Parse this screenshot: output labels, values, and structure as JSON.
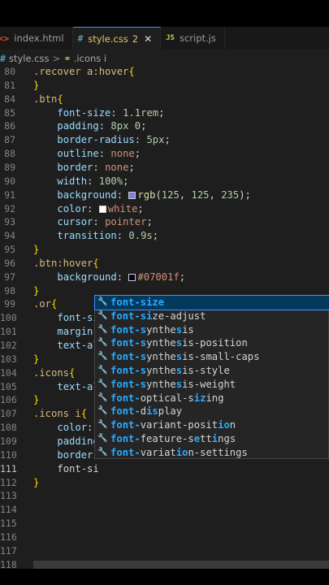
{
  "tabs": [
    {
      "icon": "<>",
      "label": "index.html",
      "badge": "",
      "active": false
    },
    {
      "icon": "#",
      "label": "style.css",
      "badge": "2",
      "active": true
    },
    {
      "icon": "JS",
      "label": "script.js",
      "badge": "",
      "active": false
    }
  ],
  "breadcrumb": {
    "file": "style.css",
    "symbol": ".icons i"
  },
  "lines": [
    {
      "n": "80",
      "html": "<span class='sel'>.recover a:hover</span><span class='br'>{</span>"
    },
    {
      "n": "81",
      "html": "<span class='br'>}</span>"
    },
    {
      "n": "84",
      "html": "<span class='sel'>.btn</span><span class='br'>{</span>"
    },
    {
      "n": "85",
      "html": "    <span class='prop'>font-size</span>: <span class='num'>1.1rem</span>;"
    },
    {
      "n": "86",
      "html": "    <span class='prop'>padding</span>: <span class='num'>8px 0</span>;"
    },
    {
      "n": "87",
      "html": "    <span class='prop'>border-radius</span>: <span class='num'>5px</span>;"
    },
    {
      "n": "88",
      "html": "    <span class='prop'>outline</span>: <span class='kw'>none</span>;"
    },
    {
      "n": "89",
      "html": "    <span class='prop'>border</span>: <span class='kw'>none</span>;"
    },
    {
      "n": "90",
      "html": "    <span class='prop'>width</span>: <span class='num'>100%</span>;"
    },
    {
      "n": "91",
      "html": "    <span class='prop'>background</span>: <span class='swatch' style='background:#7d7deb'></span><span class='fn'>rgb</span>(<span class='num'>125</span>, <span class='num'>125</span>, <span class='num'>235</span>);"
    },
    {
      "n": "92",
      "html": "    <span class='prop'>color</span>: <span class='swatch' style='background:#fff'></span><span class='kw'>white</span>;"
    },
    {
      "n": "93",
      "html": "    <span class='prop'>cursor</span>: <span class='kw'>pointer</span>;"
    },
    {
      "n": "94",
      "html": "    <span class='prop'>transition</span>: <span class='num'>0.9s</span>;"
    },
    {
      "n": "95",
      "html": "<span class='br'>}</span>"
    },
    {
      "n": "96",
      "html": "<span class='sel'>.btn:hover</span><span class='br'>{</span>"
    },
    {
      "n": "97",
      "html": "    <span class='prop'>background</span>: <span class='swatch' style='background:#07001f'></span><span class='kw'>#07001f</span>;"
    },
    {
      "n": "98",
      "html": "<span class='br'>}</span>"
    },
    {
      "n": "99",
      "html": "<span class='sel'>.or</span><span class='br'>{</span>"
    },
    {
      "n": "100",
      "html": "    <span class='prop'>font-si</span>"
    },
    {
      "n": "101",
      "html": "    <span class='prop'>margin-</span>"
    },
    {
      "n": "102",
      "html": "    <span class='prop'>text-al</span>"
    },
    {
      "n": "103",
      "html": "<span class='br'>}</span>"
    },
    {
      "n": "104",
      "html": "<span class='sel'>.icons</span><span class='br'>{</span>"
    },
    {
      "n": "105",
      "html": "    <span class='prop'>text-al</span>"
    },
    {
      "n": "106",
      "html": "<span class='br'>}</span>"
    },
    {
      "n": "107",
      "html": "<span class='sel'>.icons i</span><span class='br'>{</span>"
    },
    {
      "n": "108",
      "html": "    <span class='prop'>color</span>:"
    },
    {
      "n": "109",
      "html": "    <span class='prop'>padding</span>"
    },
    {
      "n": "110",
      "html": "    <span class='prop'>border-</span>"
    },
    {
      "n": "111",
      "html": "    <span class='pun'>font-si</span>",
      "current": true
    },
    {
      "n": "112",
      "html": "<span class='br'>}</span>"
    },
    {
      "n": "113",
      "html": ""
    },
    {
      "n": "114",
      "html": ""
    },
    {
      "n": "115",
      "html": ""
    },
    {
      "n": "116",
      "html": ""
    },
    {
      "n": "117",
      "html": ""
    },
    {
      "n": "118",
      "html": ""
    }
  ],
  "suggestions": [
    {
      "text": "font-size",
      "match": [
        0,
        1,
        2,
        3,
        4,
        5,
        6,
        7,
        8
      ]
    },
    {
      "text": "font-size-adjust",
      "match": [
        0,
        1,
        2,
        3,
        4,
        5,
        6
      ]
    },
    {
      "text": "font-synthesis",
      "match": [
        0,
        1,
        2,
        3,
        4,
        5,
        11
      ]
    },
    {
      "text": "font-synthesis-position",
      "match": [
        0,
        1,
        2,
        3,
        4,
        5,
        11
      ]
    },
    {
      "text": "font-synthesis-small-caps",
      "match": [
        0,
        1,
        2,
        3,
        4,
        5,
        11
      ]
    },
    {
      "text": "font-synthesis-style",
      "match": [
        0,
        1,
        2,
        3,
        4,
        5,
        11
      ]
    },
    {
      "text": "font-synthesis-weight",
      "match": [
        0,
        1,
        2,
        3,
        4,
        5,
        11
      ]
    },
    {
      "text": "font-optical-sizing",
      "match": [
        0,
        1,
        2,
        3,
        4,
        14,
        15
      ]
    },
    {
      "text": "font-display",
      "match": [
        0,
        1,
        2,
        3,
        4,
        6,
        7
      ]
    },
    {
      "text": "font-variant-position",
      "match": [
        0,
        1,
        2,
        3,
        4,
        18,
        19
      ]
    },
    {
      "text": "font-feature-settings",
      "match": [
        0,
        1,
        2,
        3,
        4,
        14,
        17
      ]
    },
    {
      "text": "font-variation-settings",
      "match": [
        0,
        1,
        2,
        3,
        4,
        11,
        12
      ]
    }
  ]
}
